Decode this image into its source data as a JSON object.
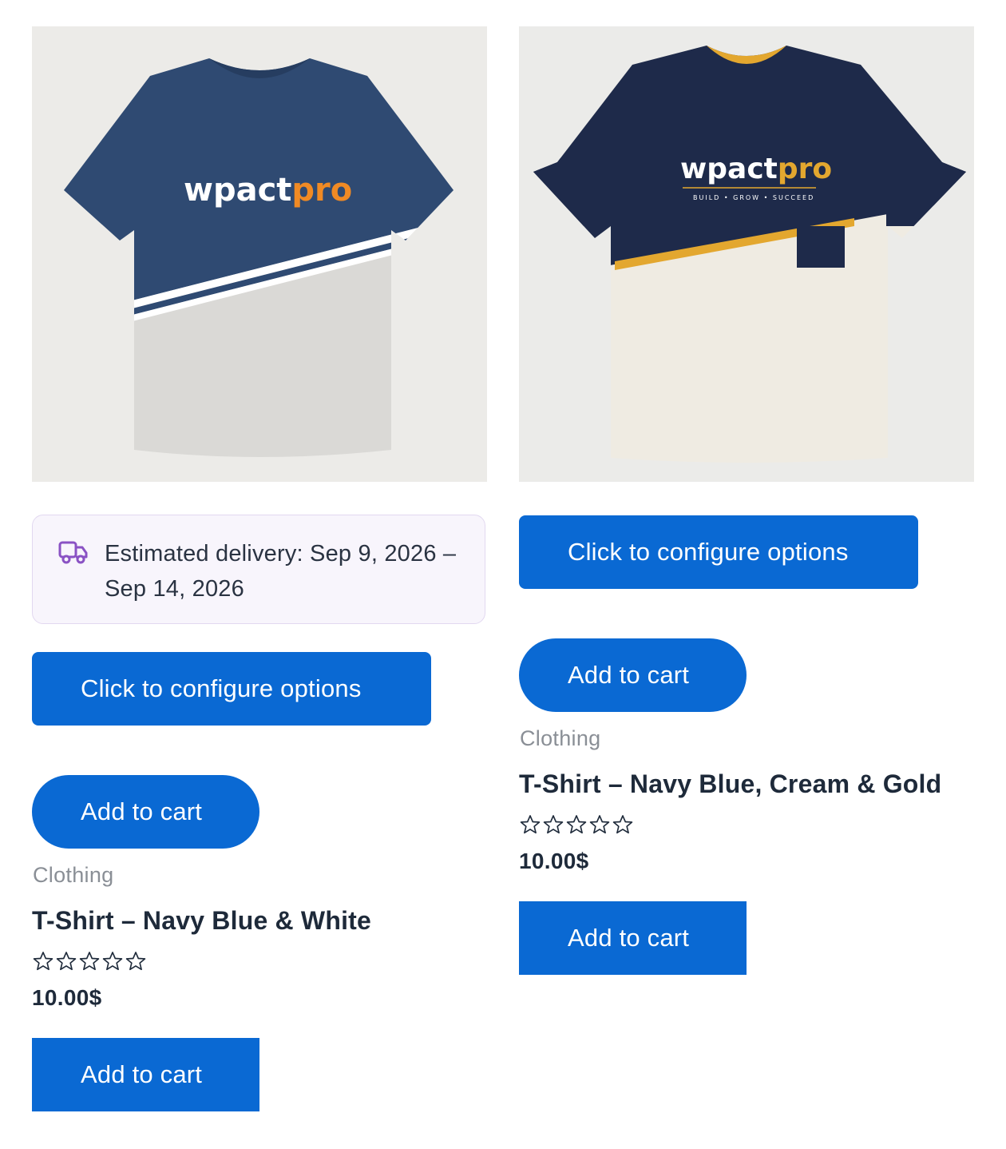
{
  "products": [
    {
      "image_alt": "T-Shirt – Navy Blue & White",
      "logo_main": "wpact",
      "logo_accent": "pro",
      "delivery_text": "Estimated delivery: Sep 9, 2026 – Sep 14, 2026",
      "configure_label": "Click to configure options",
      "add_to_cart_label": "Add to cart",
      "category": "Clothing",
      "title": "T-Shirt – Navy Blue & White",
      "rating": 0,
      "rating_max": 5,
      "price": "10.00$",
      "add_to_cart_label_2": "Add to cart",
      "colors": {
        "top": "#2f4a72",
        "bottom": "#dcdcda",
        "stripe": "#ffffff",
        "accent": "#f08a24"
      }
    },
    {
      "image_alt": "T-Shirt – Navy Blue, Cream & Gold",
      "logo_main": "wpact",
      "logo_accent": "pro",
      "logo_tagline": "BUILD • GROW • SUCCEED",
      "configure_label": "Click to configure options",
      "add_to_cart_label": "Add to cart",
      "category": "Clothing",
      "title": "T-Shirt – Navy Blue, Cream & Gold",
      "rating": 0,
      "rating_max": 5,
      "price": "10.00$",
      "add_to_cart_label_2": "Add to cart",
      "colors": {
        "top": "#1e2a4a",
        "bottom": "#efebe2",
        "stripe": "#e3a72f",
        "accent": "#e3a72f"
      }
    }
  ],
  "theme": {
    "button_color": "#0a69d3",
    "delivery_icon_color": "#8a52c4",
    "delivery_bg": "#f8f5fc"
  }
}
